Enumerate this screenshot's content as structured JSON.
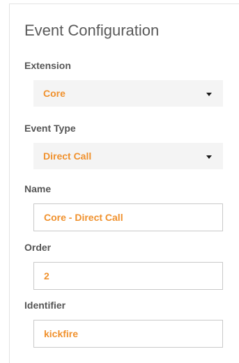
{
  "panel": {
    "title": "Event Configuration"
  },
  "fields": {
    "extension": {
      "label": "Extension",
      "value": "Core"
    },
    "event_type": {
      "label": "Event Type",
      "value": "Direct Call"
    },
    "name": {
      "label": "Name",
      "value": "Core - Direct Call"
    },
    "order": {
      "label": "Order",
      "value": "2"
    },
    "identifier": {
      "label": "Identifier",
      "value": "kickfire"
    }
  },
  "icons": {
    "dropdown": "chevron-down-icon"
  },
  "colors": {
    "accent": "#f0912d",
    "label": "#555555",
    "title": "#595959",
    "select_bg": "#f4f4f4",
    "input_border": "#c9c9c9"
  }
}
